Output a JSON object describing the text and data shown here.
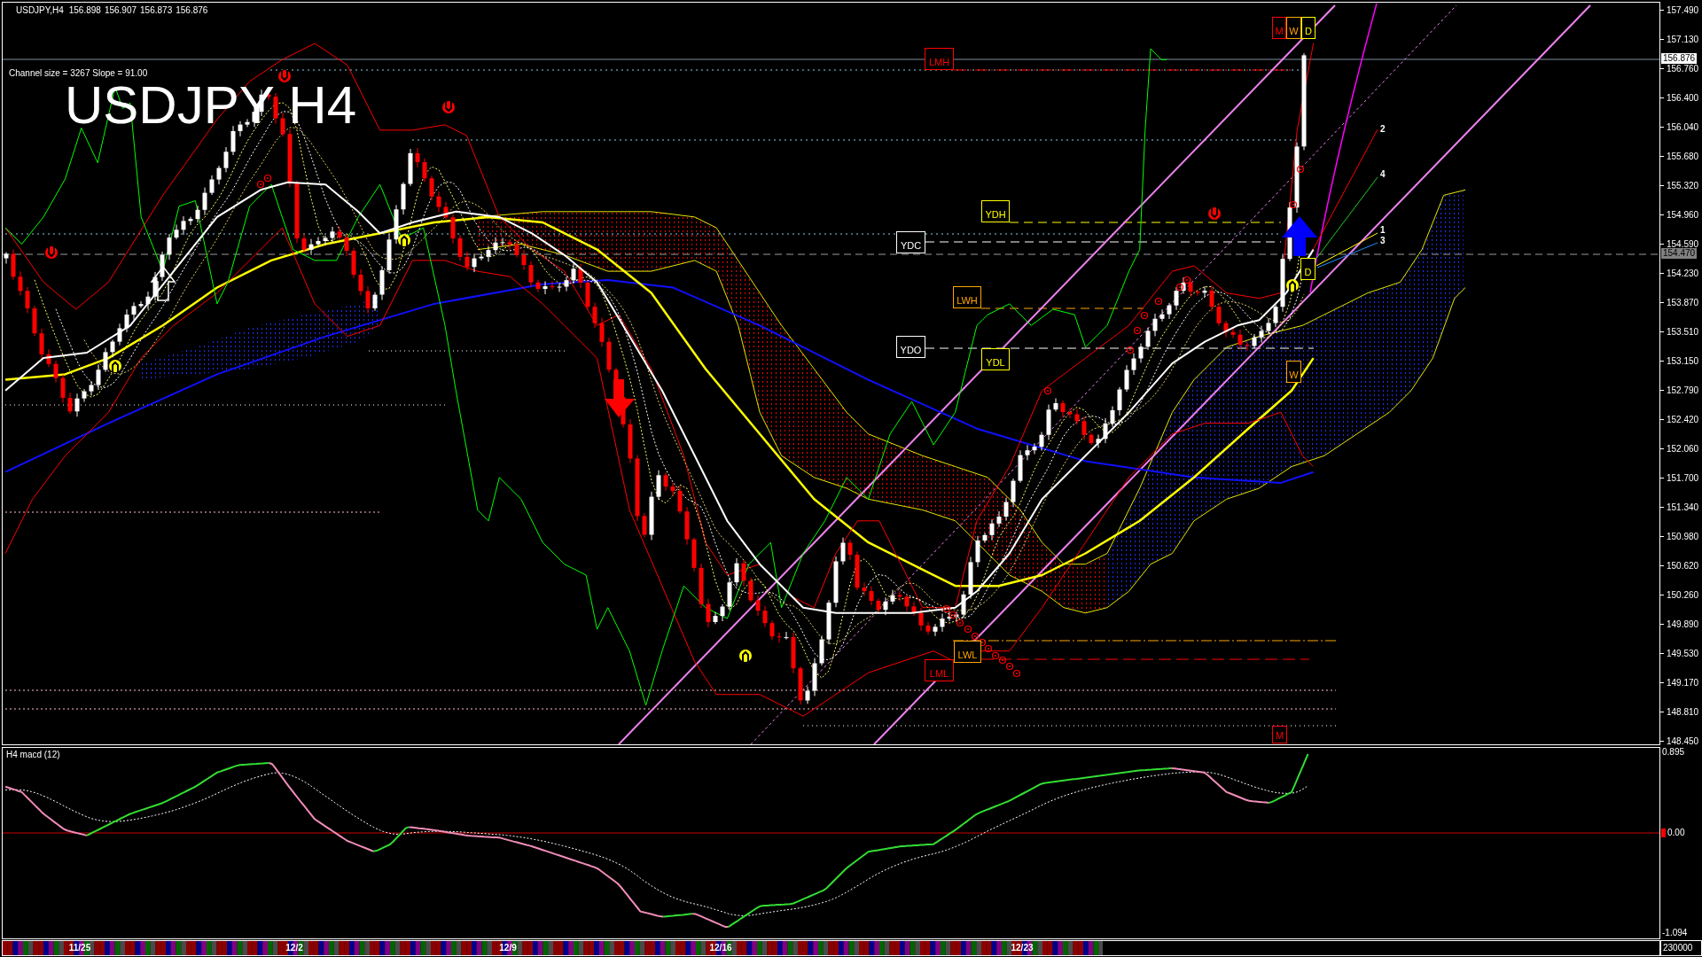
{
  "chart_header": {
    "symbol": "USDJPY,H4",
    "quotes": [
      "156.898",
      "156.907",
      "156.873",
      "156.876"
    ]
  },
  "channel_info": "Channel size = 3267 Slope = 91.00",
  "overlay_title": "USDJPY H4",
  "level_labels": [
    {
      "text": "M",
      "color": "#ff0000"
    },
    {
      "text": "W",
      "color": "#ffa500"
    },
    {
      "text": "D",
      "color": "#ffff00"
    },
    {
      "text": "LMH",
      "color": "#ff0000"
    },
    {
      "text": "YDH",
      "color": "#ffff00"
    },
    {
      "text": "YDC",
      "color": "#ffffff"
    },
    {
      "text": "D",
      "color": "#ffff00"
    },
    {
      "text": "LWH",
      "color": "#ffa500"
    },
    {
      "text": "YDO",
      "color": "#ffffff"
    },
    {
      "text": "YDL",
      "color": "#ffff00"
    },
    {
      "text": "W",
      "color": "#ffa500"
    },
    {
      "text": "LWL",
      "color": "#ffa500"
    },
    {
      "text": "LML",
      "color": "#ff0000"
    },
    {
      "text": "M",
      "color": "#ff0000"
    }
  ],
  "fan_labels": [
    "2",
    "4",
    "1",
    "3"
  ],
  "price_axis": {
    "ticks": [
      "157.490",
      "157.130",
      "156.760",
      "156.400",
      "156.040",
      "155.680",
      "155.320",
      "154.960",
      "154.590",
      "154.230",
      "153.870",
      "153.510",
      "153.150",
      "152.790",
      "152.420",
      "152.060",
      "151.700",
      "151.340",
      "150.980",
      "150.620",
      "150.260",
      "149.890",
      "149.530",
      "149.170",
      "148.810",
      "148.450"
    ],
    "markers": [
      {
        "text": "156.876",
        "kind": "bid"
      },
      {
        "text": "154.470",
        "kind": "line"
      }
    ]
  },
  "indicator_panel": {
    "title": "H4 macd (12)",
    "axis_labels": [
      "0.895",
      "0.00",
      "-1.094"
    ]
  },
  "time_axis": {
    "labels": [
      "11/25",
      "12/2",
      "12/9",
      "12/16",
      "12/23"
    ],
    "scale_value": "230000"
  }
}
